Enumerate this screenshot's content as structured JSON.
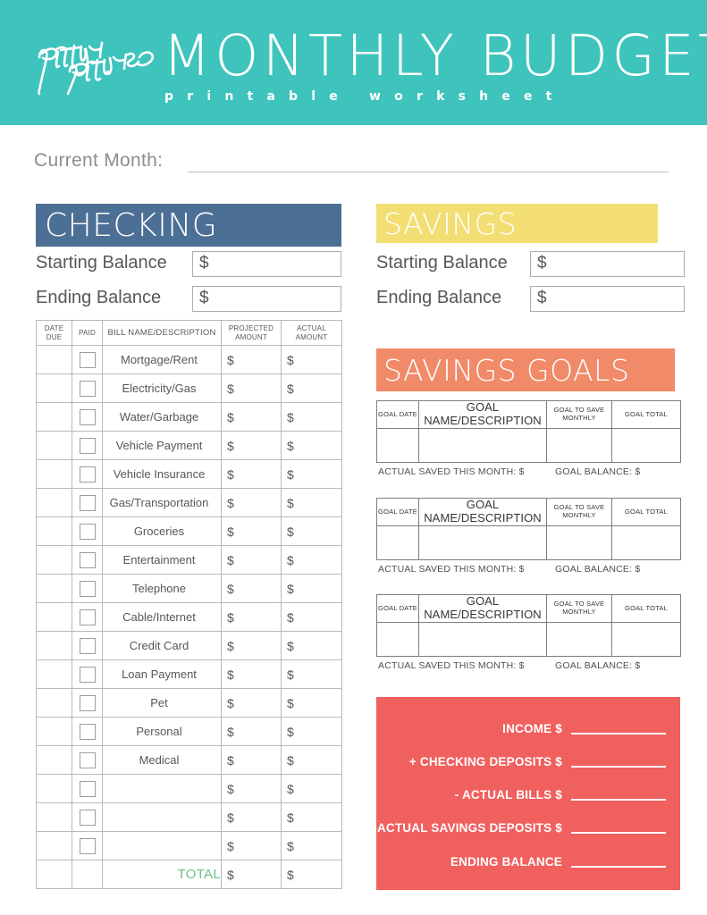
{
  "header": {
    "logo_text": "pretty presets",
    "title": "MONTHLY BUDGET",
    "subtitle": "printable worksheet",
    "banner_color": "#3fc3bd"
  },
  "current_month": {
    "label": "Current Month:",
    "value": ""
  },
  "checking": {
    "heading": "CHECKING",
    "heading_color": "#4c6f95",
    "starting_balance_label": "Starting Balance",
    "ending_balance_label": "Ending Balance",
    "starting_balance_value": "$",
    "ending_balance_value": "$",
    "table": {
      "headers": {
        "date_due": "DATE DUE",
        "paid": "PAID",
        "bill_name": "BILL NAME/DESCRIPTION",
        "projected": "PROJECTED AMOUNT",
        "actual": "ACTUAL AMOUNT"
      },
      "rows": [
        {
          "name": "Mortgage/Rent",
          "projected": "$",
          "actual": "$"
        },
        {
          "name": "Electricity/Gas",
          "projected": "$",
          "actual": "$"
        },
        {
          "name": "Water/Garbage",
          "projected": "$",
          "actual": "$"
        },
        {
          "name": "Vehicle Payment",
          "projected": "$",
          "actual": "$"
        },
        {
          "name": "Vehicle Insurance",
          "projected": "$",
          "actual": "$"
        },
        {
          "name": "Gas/Transportation",
          "projected": "$",
          "actual": "$"
        },
        {
          "name": "Groceries",
          "projected": "$",
          "actual": "$"
        },
        {
          "name": "Entertainment",
          "projected": "$",
          "actual": "$"
        },
        {
          "name": "Telephone",
          "projected": "$",
          "actual": "$"
        },
        {
          "name": "Cable/Internet",
          "projected": "$",
          "actual": "$"
        },
        {
          "name": "Credit Card",
          "projected": "$",
          "actual": "$"
        },
        {
          "name": "Loan Payment",
          "projected": "$",
          "actual": "$"
        },
        {
          "name": "Pet",
          "projected": "$",
          "actual": "$"
        },
        {
          "name": "Personal",
          "projected": "$",
          "actual": "$"
        },
        {
          "name": "Medical",
          "projected": "$",
          "actual": "$"
        },
        {
          "name": "",
          "projected": "$",
          "actual": "$"
        },
        {
          "name": "",
          "projected": "$",
          "actual": "$"
        },
        {
          "name": "",
          "projected": "$",
          "actual": "$"
        }
      ],
      "total_label": "TOTAL",
      "total_label_color": "#6cbf8c",
      "total_projected": "$",
      "total_actual": "$"
    }
  },
  "savings": {
    "heading": "SAVINGS",
    "heading_color": "#f2de73",
    "starting_balance_label": "Starting Balance",
    "ending_balance_label": "Ending Balance",
    "starting_balance_value": "$",
    "ending_balance_value": "$"
  },
  "savings_goals": {
    "heading": "SAVINGS GOALS",
    "heading_color": "#f08a69",
    "headers": {
      "goal_date": "GOAL DATE",
      "goal_name": "GOAL NAME/DESCRIPTION",
      "goal_monthly": "GOAL TO SAVE MONTHLY",
      "goal_total": "GOAL TOTAL"
    },
    "footer": {
      "actual_saved": "ACTUAL SAVED THIS MONTH: $",
      "goal_balance": "GOAL BALANCE: $"
    },
    "blocks": [
      {
        "goal_date": "",
        "goal_name": "",
        "goal_monthly": "",
        "goal_total": ""
      },
      {
        "goal_date": "",
        "goal_name": "",
        "goal_monthly": "",
        "goal_total": ""
      },
      {
        "goal_date": "",
        "goal_name": "",
        "goal_monthly": "",
        "goal_total": ""
      }
    ]
  },
  "summary": {
    "box_color": "#f0605e",
    "rows": [
      {
        "label": "INCOME $",
        "value": ""
      },
      {
        "label": "+ CHECKING DEPOSITS $",
        "value": ""
      },
      {
        "label": "- ACTUAL BILLS $",
        "value": ""
      },
      {
        "label": "-ACTUAL SAVINGS DEPOSITS $",
        "value": ""
      },
      {
        "label": "ENDING BALANCE",
        "value": ""
      }
    ]
  }
}
